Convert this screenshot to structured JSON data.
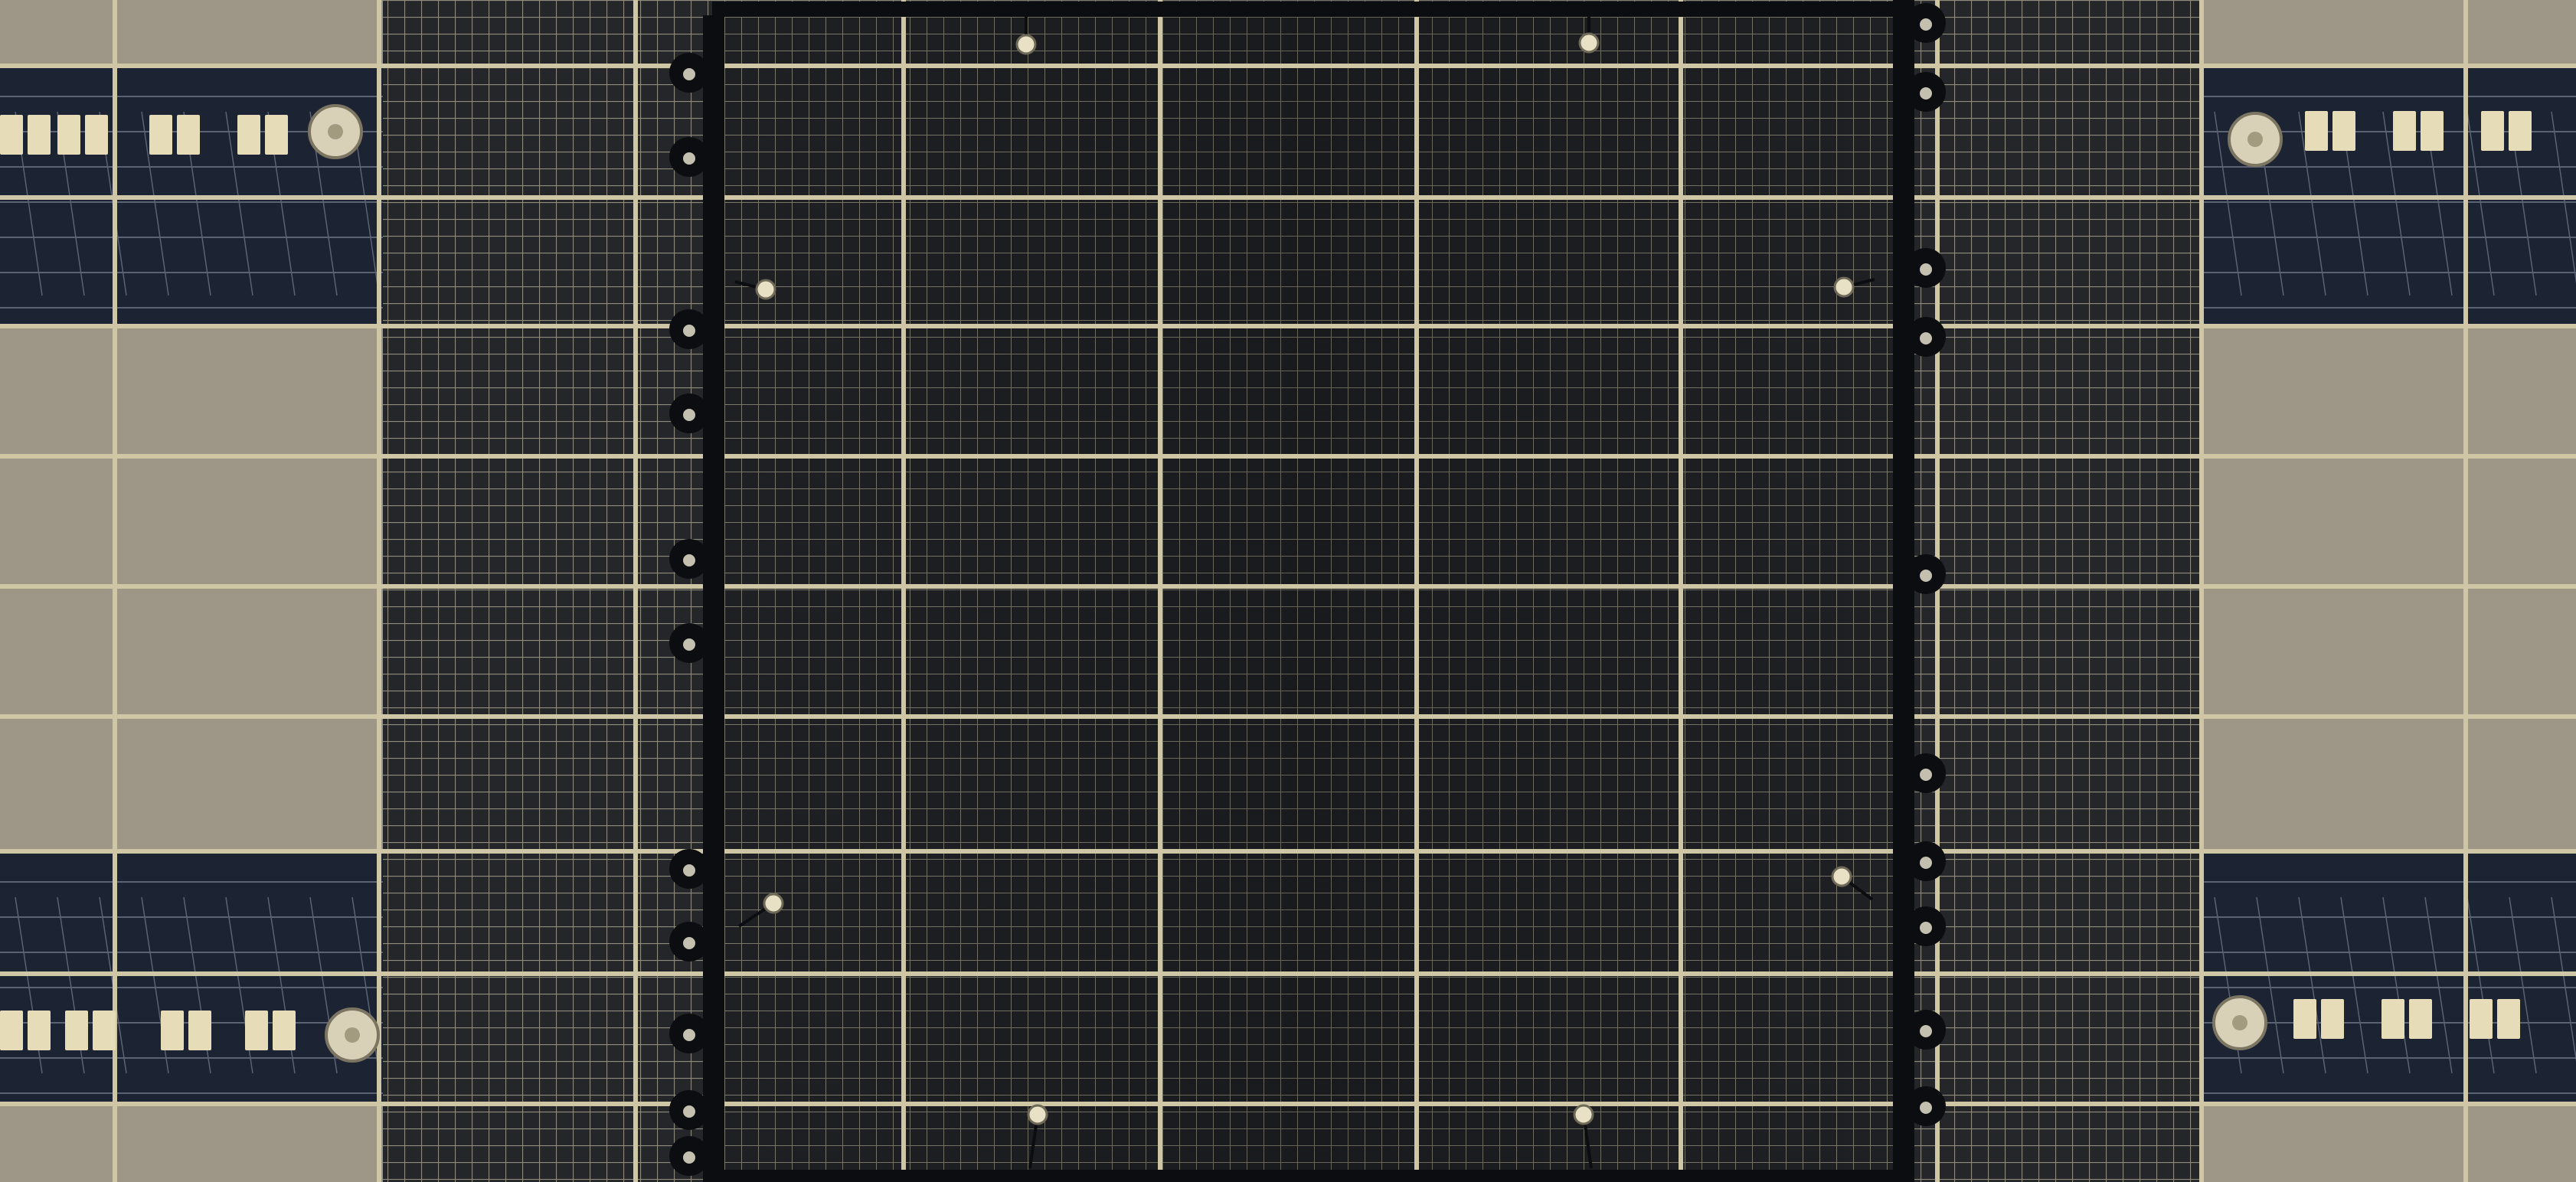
{
  "scene": {
    "description_kind": "photo",
    "subject": "ceiling-grid",
    "colors": {
      "panel_tan": "#9e9686",
      "panel_tan_dark": "#8d8676",
      "grid_line": "#cfc6a6",
      "mesh_bg": "#24262a",
      "mesh_line": "#8e8b7c",
      "window_strip": "#1c2433",
      "strip_detail": "#5b6274",
      "pad_light": "#e7dcb8",
      "rail_dark": "#0c0d10",
      "dome_light": "#d8d1b8"
    }
  }
}
